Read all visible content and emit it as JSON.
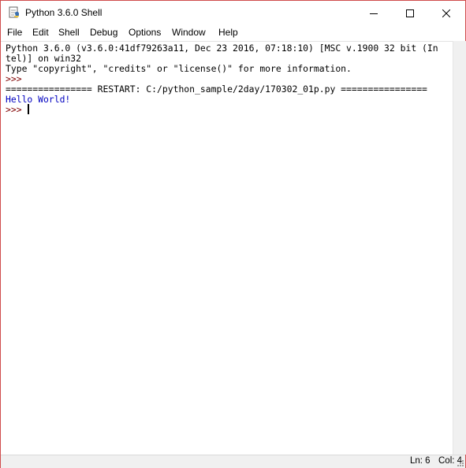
{
  "window": {
    "title": "Python 3.6.0 Shell"
  },
  "menu": {
    "file": "File",
    "edit": "Edit",
    "shell": "Shell",
    "debug": "Debug",
    "options": "Options",
    "window": "Window",
    "help": "Help"
  },
  "shell": {
    "lines": [
      "Python 3.6.0 (v3.6.0:41df79263a11, Dec 23 2016, 07:18:10) [MSC v.1900 32 bit (In",
      "tel)] on win32",
      "Type \"copyright\", \"credits\" or \"license()\" for more information.",
      ">>> ",
      "================ RESTART: C:/python_sample/2day/170302_01p.py ================",
      "Hello World!",
      ">>> "
    ]
  },
  "status": {
    "line": "Ln: 6",
    "col": "Col: 4"
  },
  "colors": {
    "border": "#d04c4c",
    "output_blue": "#0000c0",
    "prompt_maroon": "#800000"
  },
  "icons": {
    "app": "python-idle-icon",
    "minimize": "minimize-icon",
    "maximize": "maximize-icon",
    "close": "close-icon"
  }
}
